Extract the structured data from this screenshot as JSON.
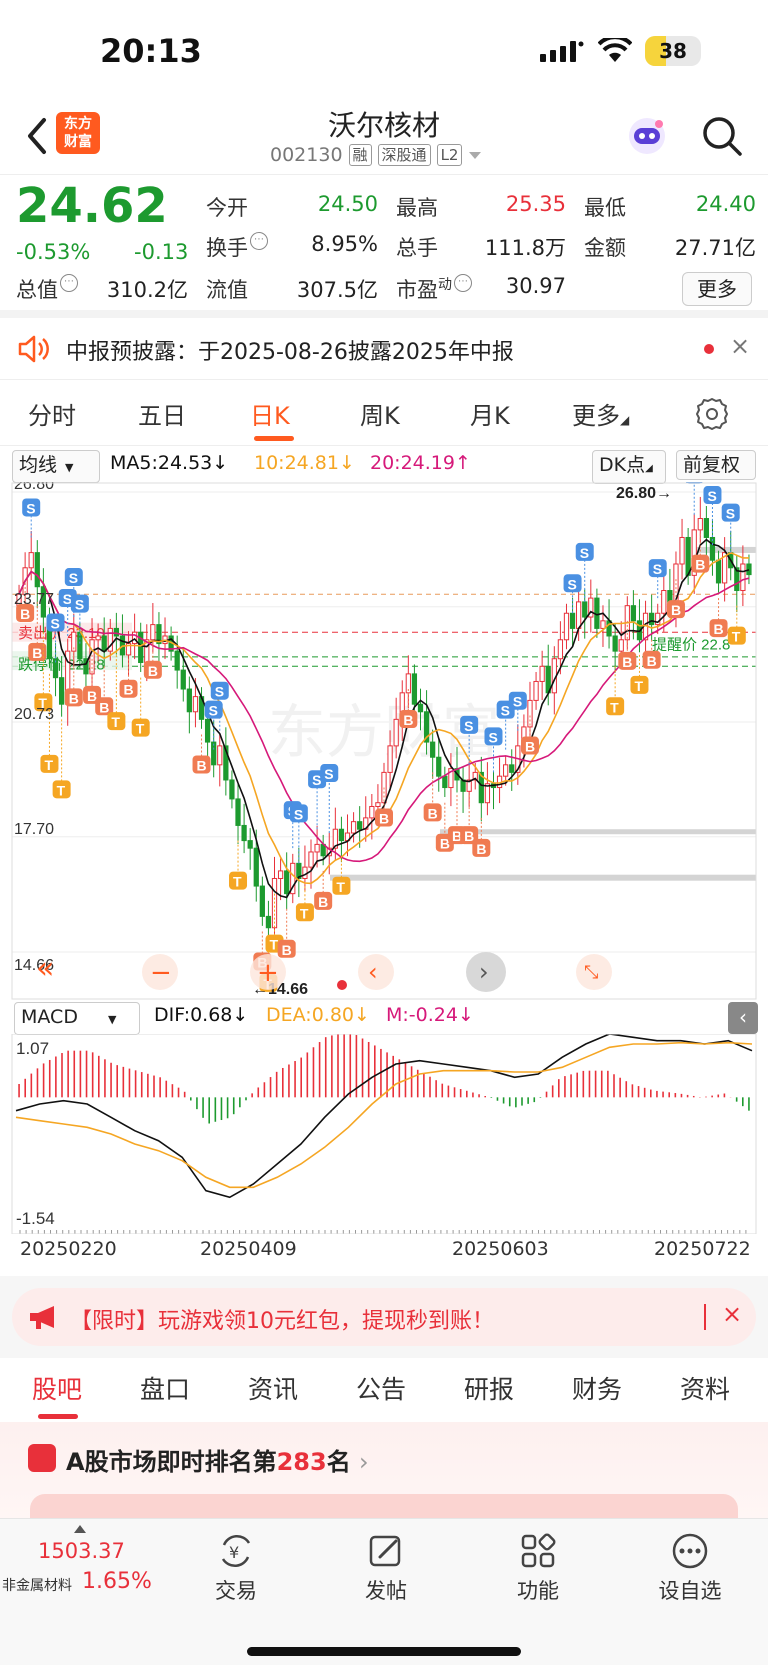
{
  "status_bar": {
    "time": "20:13",
    "battery": "38",
    "battery_level": 0.38
  },
  "header": {
    "brand_line1": "东方",
    "brand_line2": "财富",
    "stock_name": "沃尔核材",
    "stock_code": "002130",
    "tag_margin": "融",
    "tag_connect": "深股通",
    "tag_level": "L2"
  },
  "quote": {
    "price": "24.62",
    "change_pct": "-0.53%",
    "change": "-0.13",
    "open_label": "今开",
    "open_value": "24.50",
    "high_label": "最高",
    "high_value": "25.35",
    "low_label": "最低",
    "low_value": "24.40",
    "turnover_label": "换手",
    "turnover_value": "8.95%",
    "volume_label": "总手",
    "volume_value": "111.8万",
    "amount_label": "金额",
    "amount_value": "27.71亿",
    "mktcap_label": "总值",
    "mktcap_value": "310.2亿",
    "float_label": "流值",
    "float_value": "307.5亿",
    "pe_label": "市盈",
    "pe_sup": "动",
    "pe_value": "30.97",
    "more_label": "更多"
  },
  "notice": {
    "text": "中报预披露：于2025-08-26披露2025年中报",
    "close": "×"
  },
  "kline_tabs": [
    "分时",
    "五日",
    "日K",
    "周K",
    "月K",
    "更多"
  ],
  "ma_legend": {
    "selector": "均线",
    "ma5": "MA5:24.53↓",
    "ma10": "10:24.81↓",
    "ma20": "20:24.19↑",
    "dk_selector": "DK点",
    "adjust_button": "前复权"
  },
  "kline": {
    "y_labels": [
      "26.80",
      "23.77",
      "20.73",
      "17.70",
      "14.66"
    ],
    "high_marker": "26.80→",
    "low_marker": "←14.66",
    "sell_price_label": "卖出价 23.10",
    "stop_price_label": "跌停价 22.28",
    "buy_price_label": "提醒价 22.8",
    "watermark": "东方财富",
    "colors": {
      "up": "#e8303a",
      "down": "#1d9a2f",
      "ma5": "#111111",
      "ma10": "#f5a623",
      "ma20": "#d6197a"
    }
  },
  "macd_legend": {
    "selector": "MACD",
    "dif": "DIF:0.68↓",
    "dea": "DEA:0.80↓",
    "m": "M:-0.24↓",
    "y_top": "1.07",
    "y_bottom": "-1.54"
  },
  "date_axis": [
    "20250220",
    "20250409",
    "20250603",
    "20250722"
  ],
  "chart_data": {
    "type": "candlestick",
    "y_range": [
      14.66,
      26.8
    ],
    "closes": [
      24.1,
      24.8,
      25.2,
      24.3,
      23.5,
      22.4,
      21.9,
      21.2,
      22.6,
      23.1,
      22.4,
      22.0,
      22.9,
      23.0,
      22.6,
      23.2,
      23.0,
      22.5,
      22.8,
      23.1,
      22.3,
      22.9,
      23.3,
      22.8,
      23.0,
      22.6,
      22.1,
      21.6,
      21.0,
      21.4,
      20.8,
      20.2,
      19.6,
      20.1,
      19.2,
      18.7,
      18.0,
      17.6,
      17.4,
      16.4,
      15.6,
      15.3,
      16.6,
      16.8,
      16.2,
      17.0,
      16.6,
      16.9,
      17.3,
      17.5,
      17.2,
      17.4,
      17.9,
      17.6,
      17.8,
      18.1,
      17.9,
      18.2,
      18.5,
      18.6,
      19.4,
      20.1,
      20.8,
      21.5,
      22.0,
      21.2,
      21.0,
      20.2,
      19.8,
      19.3,
      19.0,
      19.5,
      19.2,
      18.9,
      19.2,
      19.4,
      18.6,
      19.1,
      19.0,
      19.3,
      19.6,
      19.4,
      20.1,
      20.6,
      21.3,
      21.8,
      22.2,
      21.5,
      22.4,
      22.9,
      23.6,
      23.2,
      23.9,
      23.5,
      24.0,
      23.2,
      23.4,
      23.0,
      22.6,
      22.9,
      23.8,
      23.4,
      22.9,
      23.6,
      23.3,
      23.6,
      24.2,
      23.8,
      24.9,
      25.6,
      24.6,
      25.8,
      26.1,
      25.6,
      25.0,
      24.4,
      25.2,
      24.8,
      24.2,
      24.9,
      24.62
    ],
    "dif": [
      -0.2,
      -0.1,
      -0.05,
      -0.1,
      -0.3,
      -0.5,
      -0.65,
      -0.9,
      -1.4,
      -1.5,
      -1.3,
      -1.0,
      -0.7,
      -0.3,
      0.05,
      0.3,
      0.5,
      0.55,
      0.5,
      0.45,
      0.4,
      0.3,
      0.35,
      0.6,
      0.8,
      0.95,
      0.9,
      0.85,
      0.85,
      0.8,
      0.85,
      0.7
    ],
    "dea": [
      -0.3,
      -0.35,
      -0.4,
      -0.45,
      -0.55,
      -0.7,
      -0.8,
      -0.95,
      -1.2,
      -1.35,
      -1.35,
      -1.2,
      -1.0,
      -0.75,
      -0.45,
      -0.1,
      0.2,
      0.35,
      0.4,
      0.4,
      0.4,
      0.38,
      0.38,
      0.45,
      0.6,
      0.75,
      0.8,
      0.8,
      0.82,
      0.8,
      0.82,
      0.8
    ],
    "m_range": [
      -1.54,
      1.07
    ]
  },
  "promo": {
    "text": "【限时】玩游戏领10元红包，提现秒到账！",
    "close": "×"
  },
  "content_tabs": [
    "股吧",
    "盘口",
    "资讯",
    "公告",
    "研报",
    "财务",
    "资料"
  ],
  "rank": {
    "prefix": "A股市场即时排名第",
    "number": "283",
    "suffix": "名",
    "arrow": "›"
  },
  "bottom_nav": {
    "index_value": "1503.37",
    "index_name": "非金属材料",
    "index_pct": "1.65%",
    "items": [
      "交易",
      "发帖",
      "功能",
      "设自选"
    ]
  }
}
